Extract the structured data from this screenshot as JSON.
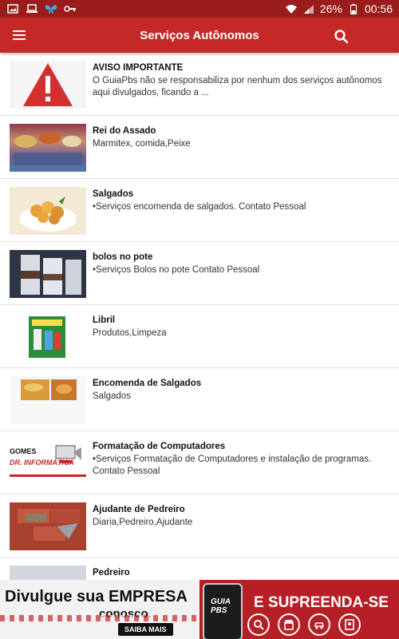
{
  "status_bar": {
    "battery": "26%",
    "time": "00:56",
    "icons": [
      "image-icon",
      "laptop-icon",
      "butterfly-icon",
      "key-icon",
      "wifi-icon",
      "signal-icon",
      "battery-icon"
    ]
  },
  "appbar": {
    "title": "Serviços Autônomos",
    "menu_icon": "menu-icon",
    "search_icon": "search-icon"
  },
  "items": [
    {
      "title": "AVISO IMPORTANTE",
      "desc": "O GuiaPbs não se responsabiliza por nenhum dos serviços autônomos aqui divulgados, ficando a ..."
    },
    {
      "title": "Rei do Assado",
      "desc": "Marmitex, comida,Peixe"
    },
    {
      "title": "Salgados",
      "desc": "•Serviços encomenda de salgados. Contato Pessoal"
    },
    {
      "title": "bolos no pote",
      "desc": "•Serviços Bolos no pote Contato Pessoal"
    },
    {
      "title": "Libril",
      "desc": "Produtos,Limpeza"
    },
    {
      "title": "Encomenda de Salgados",
      "desc": "Salgados"
    },
    {
      "title": "Formatação de Computadores",
      "desc": "•Serviços Formatação de Computadores e instalação de programas. Contato Pessoal"
    },
    {
      "title": "Ajudante de Pedreiro",
      "desc": "Diaria,Pedreiro,Ajudante"
    },
    {
      "title": "Pedreiro",
      "desc": ""
    }
  ],
  "thumbnails": {
    "gomes_logo_line1": "GOMES",
    "gomes_logo_line2": "DR. INFORMÁTICA"
  },
  "banner": {
    "line1": "Divulgue sua EMPRESA",
    "line2": "conosco.",
    "button": "SAIBA MAIS",
    "right_text": "E SUPREENDA-SE",
    "logo": "GUIA PBS"
  },
  "colors": {
    "status_bar": "#9b1c1c",
    "appbar": "#c62828",
    "warning_red": "#d32f2f"
  }
}
